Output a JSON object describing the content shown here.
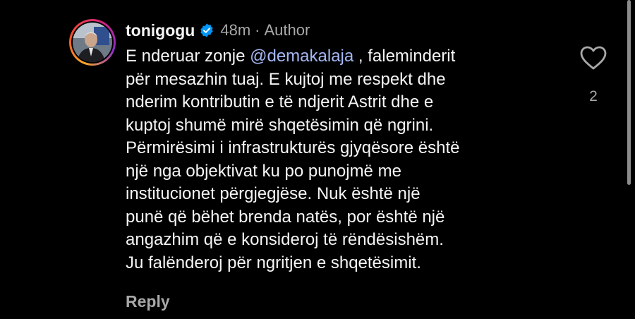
{
  "comment": {
    "username": "tonigogu",
    "verified": true,
    "time": "48m",
    "separator": "·",
    "role": "Author",
    "lines": [
      {
        "pre": "E nderuar zonje ",
        "mention": "@demakalaja",
        "post": " , faleminderit"
      },
      {
        "text": "për mesazhin tuaj. E kujtoj me respekt dhe"
      },
      {
        "text": "nderim kontributin e të ndjerit Astrit dhe e"
      },
      {
        "text": "kuptoj shumë mirë shqetësimin që ngrini."
      },
      {
        "text": "Përmirësimi i infrastrukturës gjyqësore është"
      },
      {
        "text": "një nga objektivat ku po punojmë me"
      },
      {
        "text": "institucionet përgjegjëse. Nuk është një"
      },
      {
        "text": "punë që bëhet brenda natës, por është një"
      },
      {
        "text": "angazhim që e konsideroj të rëndësishëm."
      },
      {
        "text": "Ju falënderoj për ngritjen e shqetësimit."
      }
    ],
    "reply_label": "Reply",
    "like_count": "2"
  },
  "icons": {
    "verified": "verified-badge-icon",
    "like": "heart-outline-icon"
  },
  "colors": {
    "background": "#000000",
    "text": "#f5f5f5",
    "muted": "#a8a8a8",
    "mention": "#a5b8f5",
    "verified": "#0095f6"
  }
}
